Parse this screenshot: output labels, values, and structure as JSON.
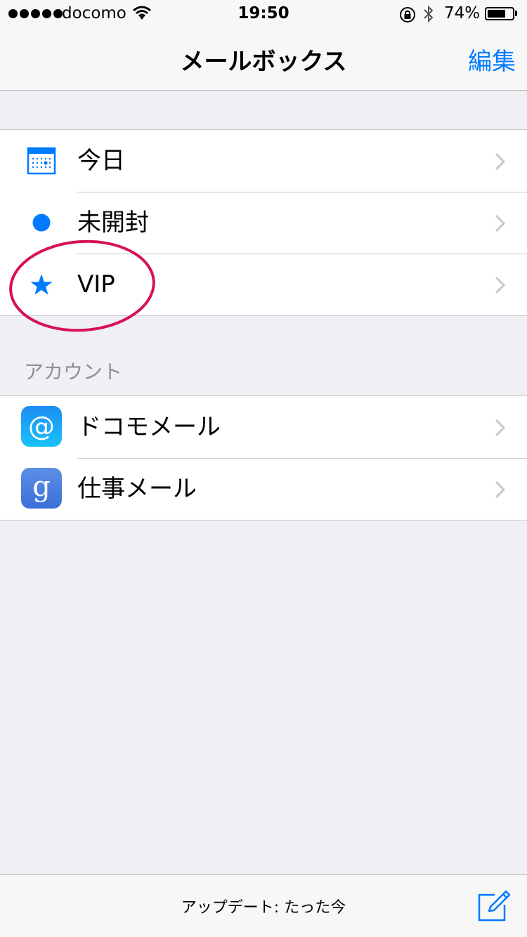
{
  "status_bar": {
    "carrier": "docomo",
    "time": "19:50",
    "battery_percent": "74%",
    "battery_level": 0.74,
    "signal_bars": 5,
    "icons": [
      "wifi-icon",
      "rotation-lock-icon",
      "bluetooth-icon",
      "battery-icon"
    ]
  },
  "nav": {
    "title": "メールボックス",
    "edit_label": "編集"
  },
  "mailboxes": [
    {
      "label": "今日",
      "icon": "calendar-icon"
    },
    {
      "label": "未開封",
      "icon": "unread-dot-icon"
    },
    {
      "label": "VIP",
      "icon": "star-icon"
    }
  ],
  "accounts_header": "アカウント",
  "accounts": [
    {
      "label": "ドコモメール",
      "icon": "docomo-mail-icon"
    },
    {
      "label": "仕事メール",
      "icon": "google-icon"
    }
  ],
  "toolbar": {
    "update_status": "アップデート: たった今",
    "compose_icon": "compose-icon"
  },
  "colors": {
    "accent": "#007aff",
    "background": "#efeff4",
    "annotation": "#d7115a"
  }
}
